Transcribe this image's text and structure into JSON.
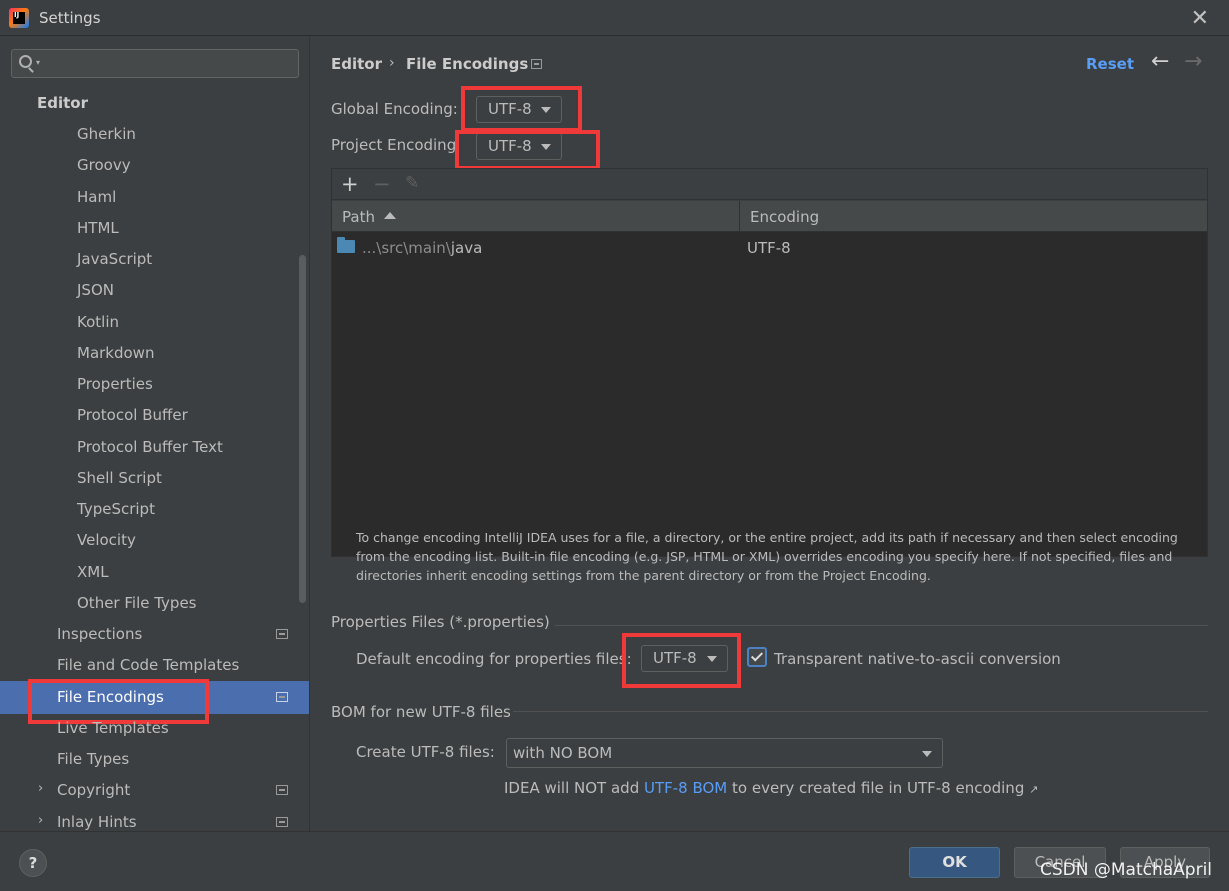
{
  "window": {
    "title": "Settings",
    "logo_text": "IJ"
  },
  "sidebar": {
    "search_placeholder": "",
    "section": "Editor",
    "children": [
      "Gherkin",
      "Groovy",
      "Haml",
      "HTML",
      "JavaScript",
      "JSON",
      "Kotlin",
      "Markdown",
      "Properties",
      "Protocol Buffer",
      "Protocol Buffer Text",
      "Shell Script",
      "TypeScript",
      "Velocity",
      "XML",
      "Other File Types"
    ],
    "items": [
      "Inspections",
      "File and Code Templates",
      "File Encodings",
      "Live Templates",
      "File Types",
      "Copyright",
      "Inlay Hints"
    ],
    "selected": "File Encodings"
  },
  "breadcrumb": {
    "parent": "Editor",
    "separator": "›",
    "current": "File Encodings"
  },
  "header": {
    "reset": "Reset",
    "back": "←",
    "forward": "→"
  },
  "encoding": {
    "global_label": "Global Encoding:",
    "global_value": "UTF-8",
    "project_label": "Project Encoding",
    "project_value": "UTF-8"
  },
  "table": {
    "toolbar": {
      "add": "+",
      "remove": "−",
      "edit": "✎"
    },
    "columns": [
      "Path",
      "Encoding"
    ],
    "rows": [
      {
        "path_prefix": "...\\src\\main\\",
        "path_tail": "java",
        "encoding": "UTF-8"
      }
    ]
  },
  "note": "To change encoding IntelliJ IDEA uses for a file, a directory, or the entire project, add its path if necessary and then select encoding from the encoding list. Built-in file encoding (e.g. JSP, HTML or XML) overrides encoding you specify here. If not specified, files and directories inherit encoding settings from the parent directory or from the Project Encoding.",
  "properties": {
    "title": "Properties Files (*.properties)",
    "default_label": "Default encoding for properties files:",
    "default_value": "UTF-8",
    "native_ascii_label": "Transparent native-to-ascii conversion",
    "native_ascii_checked": true
  },
  "bom": {
    "title": "BOM for new UTF-8 files",
    "create_label": "Create UTF-8 files:",
    "create_value": "with NO BOM",
    "info_before": "IDEA will NOT add ",
    "info_link": "UTF-8 BOM",
    "info_after": " to every created file in UTF-8 encoding",
    "info_arrow": "↗"
  },
  "footer": {
    "help": "?",
    "ok": "OK",
    "cancel": "Cancel",
    "apply": "Apply",
    "watermark": "CSDN @MatchaApril"
  },
  "colors": {
    "accent": "#4b6eaf",
    "link": "#589df6",
    "highlight": "#f03a3a",
    "ok_button": "#365880"
  }
}
